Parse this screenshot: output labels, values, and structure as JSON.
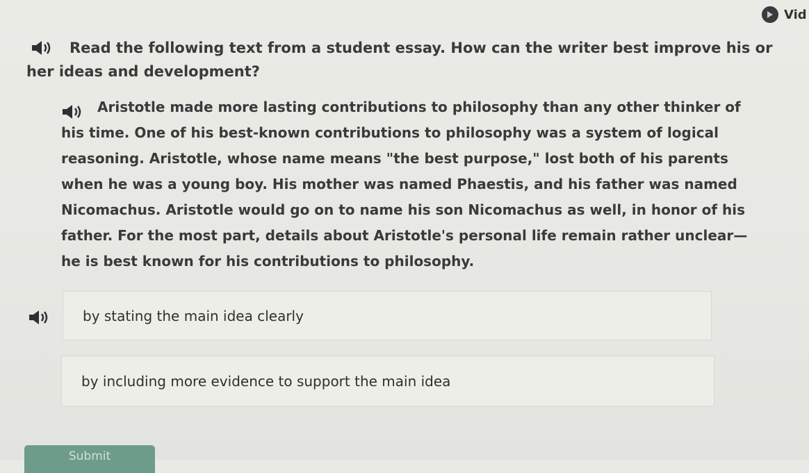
{
  "header": {
    "video_label": "Vid"
  },
  "question": {
    "text": "Read the following text from a student essay. How can the writer best improve his or her ideas and development?"
  },
  "passage": {
    "text": "Aristotle made more lasting contributions to philosophy than any other thinker of his time. One of his best-known contributions to philosophy was a system of logical reasoning. Aristotle, whose name means \"the best purpose,\" lost both of his parents when he was a young boy. His mother was named Phaestis, and his father was named Nicomachus. Aristotle would go on to name his son Nicomachus as well, in honor of his father. For the most part, details about Aristotle's personal life remain rather unclear—he is best known for his contributions to philosophy."
  },
  "choices": [
    {
      "label": "by stating the main idea clearly"
    },
    {
      "label": "by including more evidence to support the main idea"
    }
  ],
  "submit_label": "Submit"
}
